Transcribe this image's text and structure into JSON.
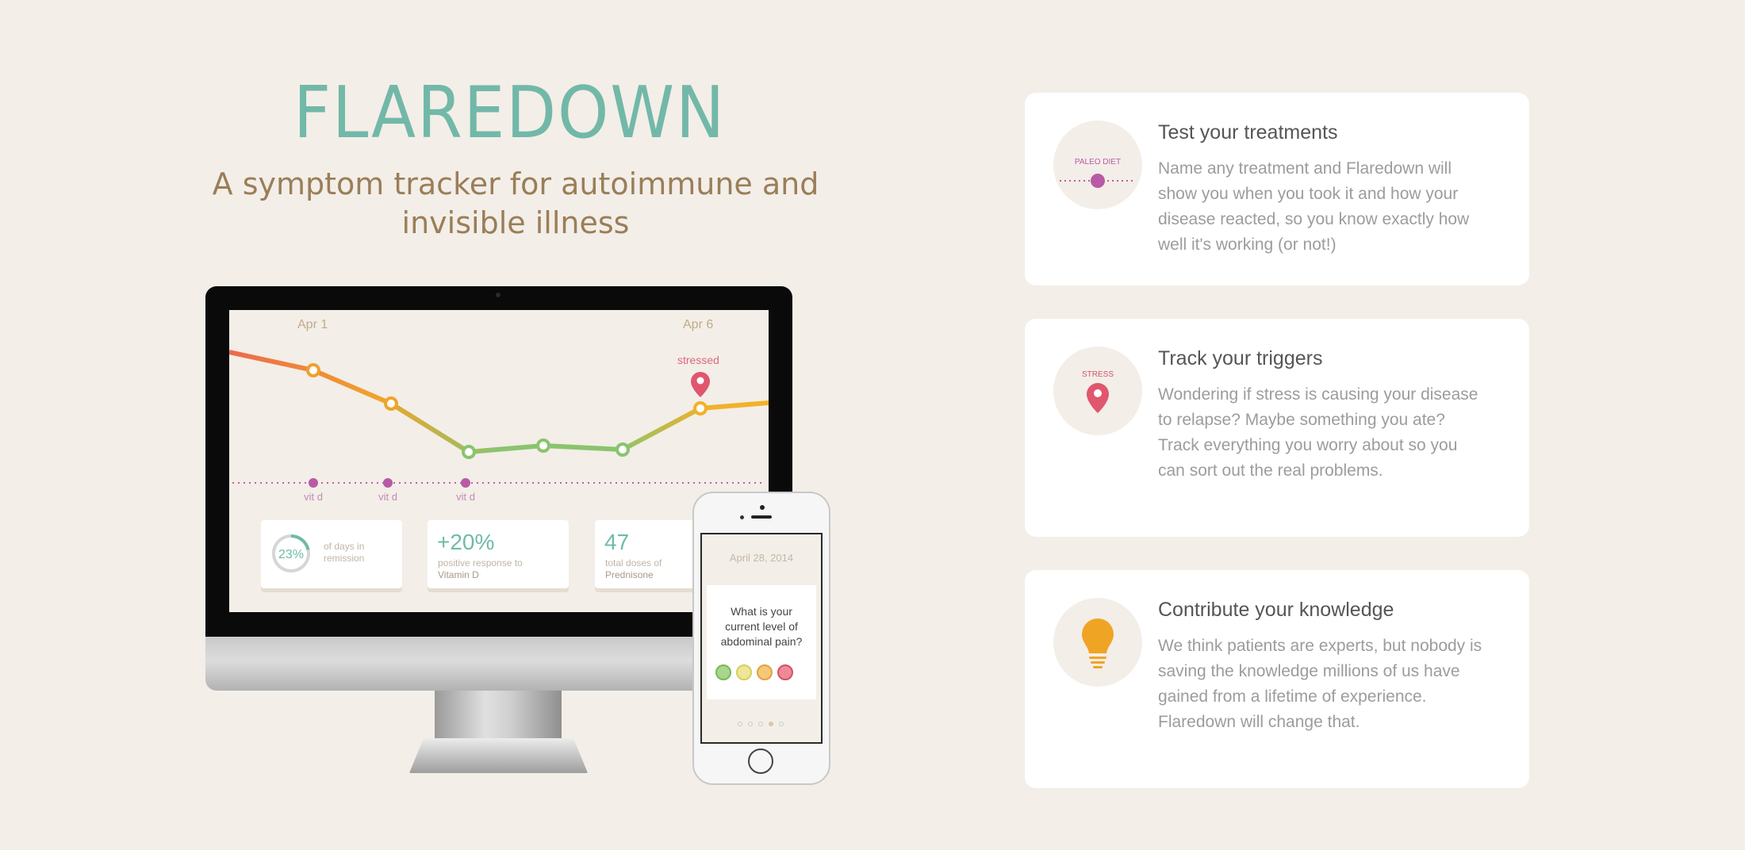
{
  "brand": {
    "logo_text": "FLAREDOWN",
    "logo_color": "#72b8a8"
  },
  "hero": {
    "tagline_line1": "A symptom tracker for autoimmune and",
    "tagline_line2": "invisible illness"
  },
  "monitor_screen": {
    "date_start": "Apr 1",
    "date_end": "Apr 6",
    "trigger_label": "stressed",
    "treatment_labels": [
      "vit d",
      "vit d",
      "vit d"
    ],
    "stats": [
      {
        "value": "23%",
        "caption_line1": "of days in",
        "caption_line2": "remission"
      },
      {
        "value": "+20%",
        "caption_line1": "positive response to",
        "caption_line2": "Vitamin D"
      },
      {
        "value": "47",
        "caption_line1": "total doses of",
        "caption_line2": "Prednisone"
      }
    ]
  },
  "phone_screen": {
    "date": "April 28, 2014",
    "question": "What is your current level of abdominal pain?",
    "face_colors": [
      "#8fc86a",
      "#e6dc6a",
      "#f0b04a",
      "#e4566e"
    ]
  },
  "features": [
    {
      "icon": "paleo-diet-icon",
      "icon_label": "PALEO DIET",
      "title": "Test your treatments",
      "description": "Name any treatment and Flaredown will show you when you took it and how your disease reacted, so you know exactly how well it's working (or not!)"
    },
    {
      "icon": "stress-pin-icon",
      "icon_label": "STRESS",
      "title": "Track your triggers",
      "description": "Wondering if stress is causing your disease to relapse? Maybe something you ate? Track everything you worry about so you can sort out the real problems."
    },
    {
      "icon": "lightbulb-icon",
      "icon_label": "",
      "title": "Contribute your knowledge",
      "description": "We think patients are experts, but nobody is saving the knowledge millions of us have gained from a lifetime of experience. Flaredown will change that."
    }
  ]
}
